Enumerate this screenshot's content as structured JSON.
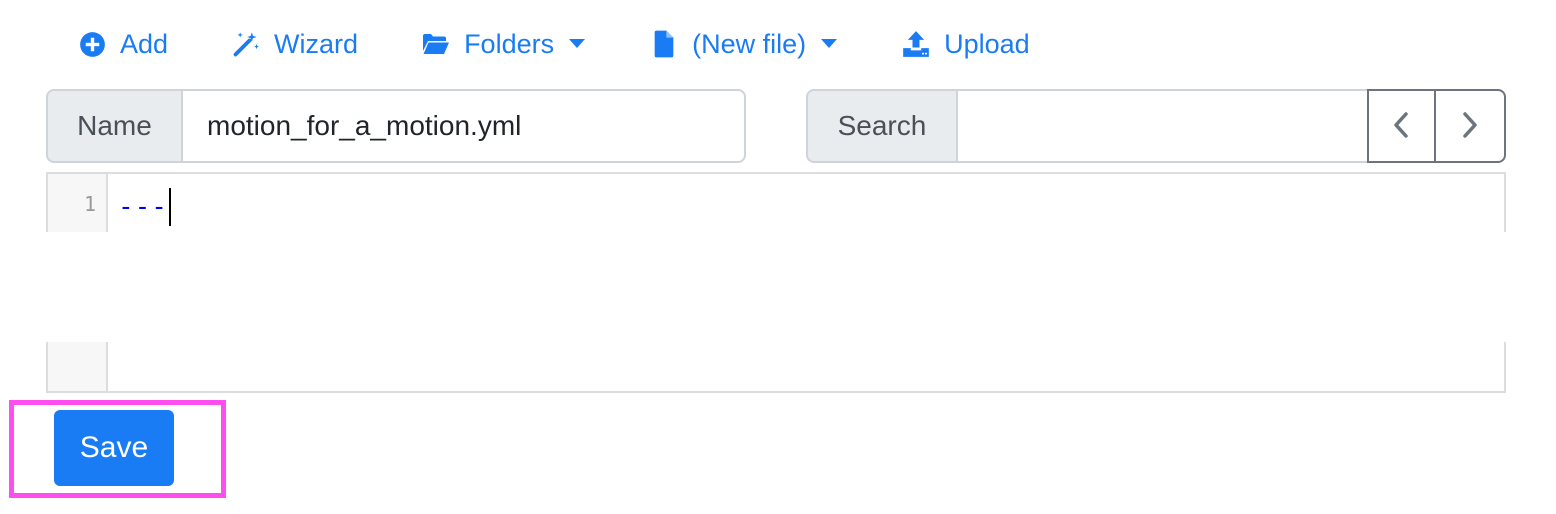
{
  "toolbar": {
    "add_label": "Add",
    "wizard_label": "Wizard",
    "folders_label": "Folders",
    "file_label": "(New file)",
    "upload_label": "Upload"
  },
  "name_field": {
    "label": "Name",
    "value": "motion_for_a_motion.yml"
  },
  "search_field": {
    "label": "Search",
    "value": ""
  },
  "editor": {
    "line_number": "1",
    "line_text": "---"
  },
  "save_label": "Save",
  "colors": {
    "accent": "#1a7cf5",
    "highlight": "#ff4ef0",
    "code_text": "#0000ff"
  },
  "icons": {
    "add": "plus-circle-icon",
    "wizard": "magic-wand-icon",
    "folders": "folder-open-icon",
    "file": "file-icon",
    "upload": "upload-icon",
    "prev": "chevron-left-icon",
    "next": "chevron-right-icon"
  }
}
